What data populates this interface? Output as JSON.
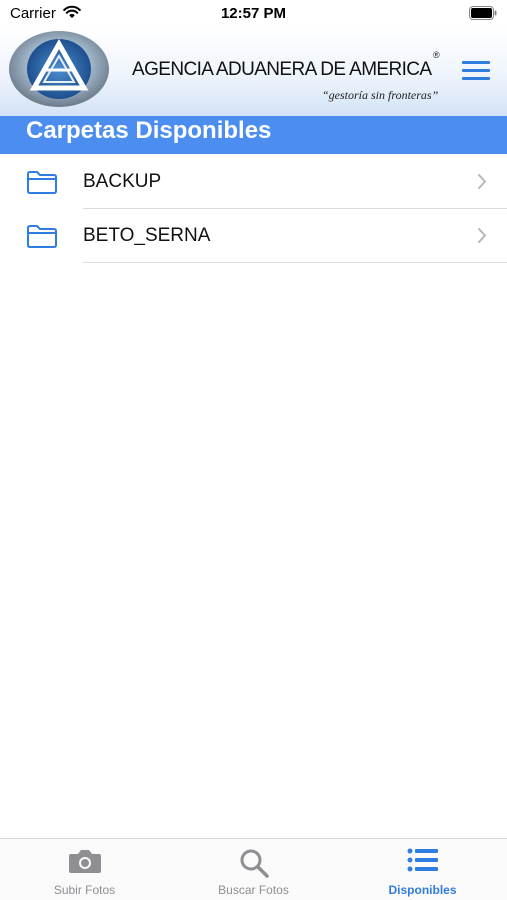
{
  "status_bar": {
    "carrier": "Carrier",
    "time": "12:57 PM"
  },
  "header": {
    "brand_name": "AGENCIA ADUANERA DE AMERICA",
    "registered": "®",
    "tagline": "“gestoría sin fronteras”"
  },
  "section": {
    "title": "Carpetas Disponibles"
  },
  "folders": [
    {
      "label": "BACKUP"
    },
    {
      "label": "BETO_SERNA"
    }
  ],
  "tabs": [
    {
      "label": "Subir Fotos",
      "icon": "camera-icon",
      "active": false
    },
    {
      "label": "Buscar Fotos",
      "icon": "search-icon",
      "active": false
    },
    {
      "label": "Disponibles",
      "icon": "list-icon",
      "active": true
    }
  ],
  "colors": {
    "accent": "#2f7de1",
    "section_bar": "#4b8ef0",
    "tab_inactive": "#8e8e93"
  }
}
